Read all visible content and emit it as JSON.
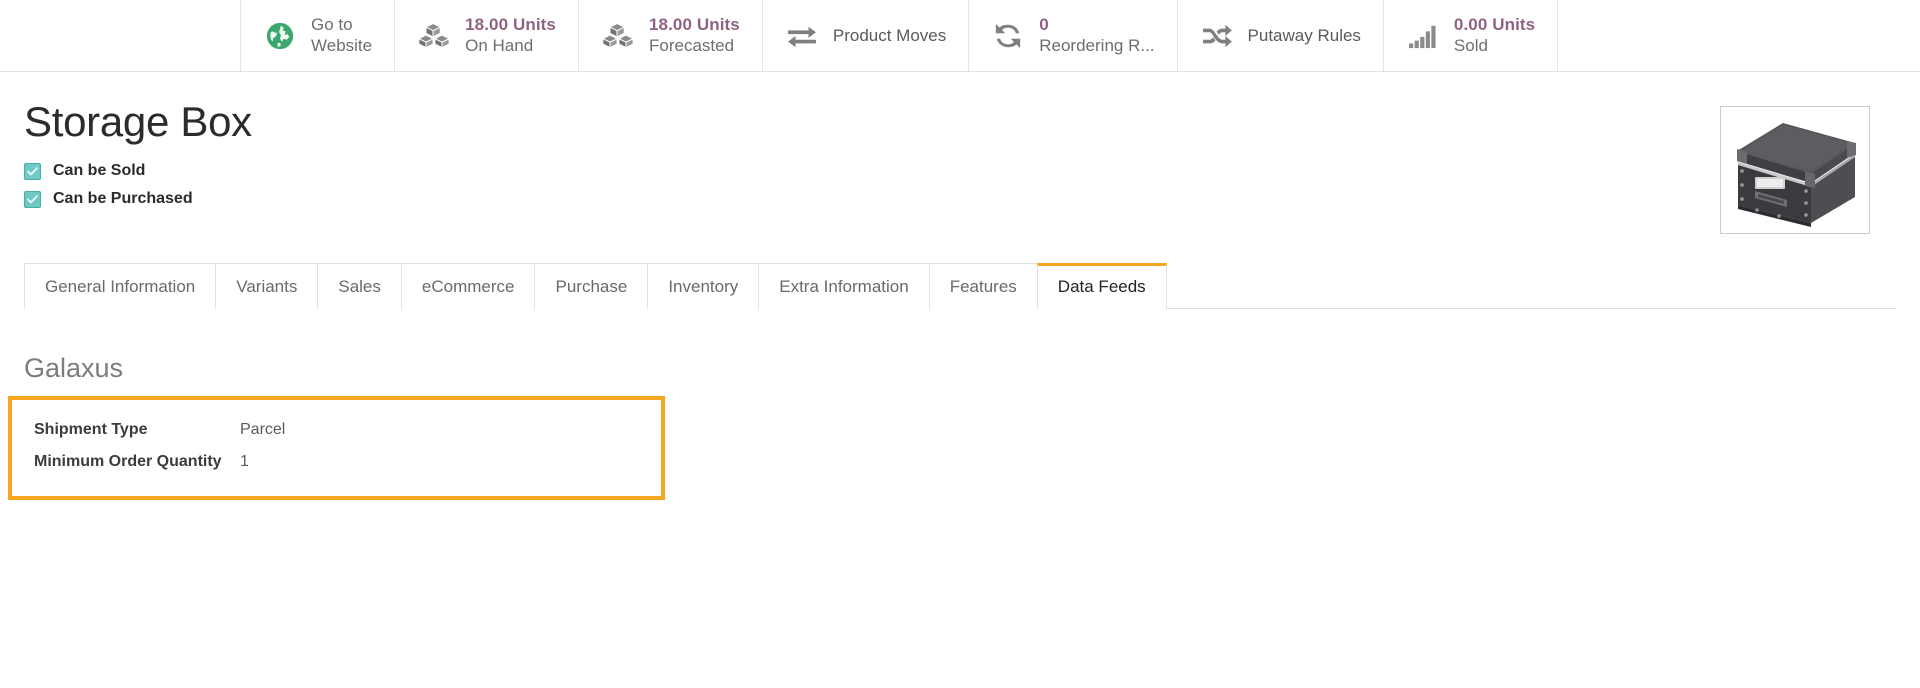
{
  "statbar": {
    "buttons": [
      {
        "icon": "globe-icon",
        "value": "",
        "label": "Go to Website",
        "single": false,
        "two_line_label": "Go to\nWebsite"
      },
      {
        "icon": "cubes-icon",
        "value": "18.00 Units",
        "label": "On Hand",
        "single": false
      },
      {
        "icon": "cubes-icon",
        "value": "18.00 Units",
        "label": "Forecasted",
        "single": false
      },
      {
        "icon": "exchange-icon",
        "value": "",
        "label": "Product Moves",
        "single": true
      },
      {
        "icon": "refresh-icon",
        "value": "0",
        "label": "Reordering R...",
        "single": false
      },
      {
        "icon": "shuffle-icon",
        "value": "",
        "label": "Putaway Rules",
        "single": true
      },
      {
        "icon": "bar-chart-icon",
        "value": "0.00 Units",
        "label": "Sold",
        "single": false
      }
    ],
    "go_to_website_line1": "Go to",
    "go_to_website_line2": "Website"
  },
  "product": {
    "title": "Storage Box",
    "image_alt": "storage-box-photo",
    "checkboxes": [
      {
        "label": "Can be Sold",
        "checked": true
      },
      {
        "label": "Can be Purchased",
        "checked": true
      }
    ]
  },
  "tabs": [
    {
      "label": "General Information",
      "active": false
    },
    {
      "label": "Variants",
      "active": false
    },
    {
      "label": "Sales",
      "active": false
    },
    {
      "label": "eCommerce",
      "active": false
    },
    {
      "label": "Purchase",
      "active": false
    },
    {
      "label": "Inventory",
      "active": false
    },
    {
      "label": "Extra Information",
      "active": false
    },
    {
      "label": "Features",
      "active": false
    },
    {
      "label": "Data Feeds",
      "active": true
    }
  ],
  "data_feeds": {
    "group_title": "Galaxus",
    "fields": [
      {
        "label": "Shipment Type",
        "value": "Parcel"
      },
      {
        "label": "Minimum Order Quantity",
        "value": "1"
      }
    ]
  },
  "colors": {
    "accent_orange": "#f5a623",
    "stat_value_purple": "#8f6384",
    "checkbox_teal": "#71c9c5",
    "globe_green": "#3aa86c",
    "icon_gray": "#7f7f7f"
  }
}
